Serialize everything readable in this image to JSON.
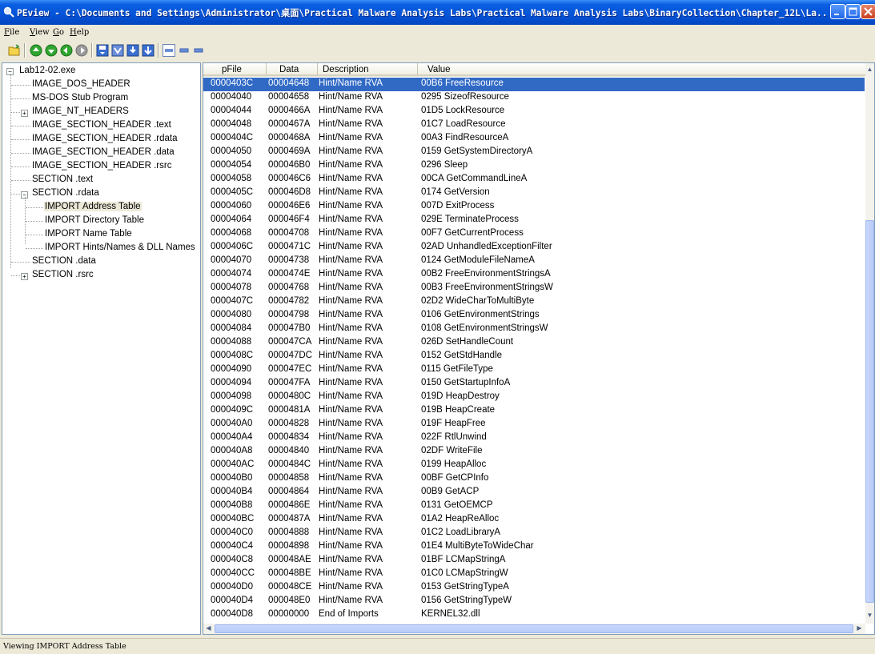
{
  "window": {
    "title": "PEview - C:\\Documents and Settings\\Administrator\\桌面\\Practical Malware Analysis Labs\\Practical Malware Analysis Labs\\BinaryCollection\\Chapter_12L\\La..."
  },
  "menu": {
    "items": [
      "File",
      "View",
      "Go",
      "Help"
    ]
  },
  "tree": {
    "root": "Lab12-02.exe",
    "items": [
      "IMAGE_DOS_HEADER",
      "MS-DOS Stub Program",
      "IMAGE_NT_HEADERS",
      "IMAGE_SECTION_HEADER .text",
      "IMAGE_SECTION_HEADER .rdata",
      "IMAGE_SECTION_HEADER .data",
      "IMAGE_SECTION_HEADER .rsrc",
      "SECTION .text",
      "SECTION .rdata",
      "IMPORT Address Table",
      "IMPORT Directory Table",
      "IMPORT Name Table",
      "IMPORT Hints/Names & DLL Names",
      "SECTION .data",
      "SECTION .rsrc"
    ],
    "expanders": {
      "root": "−",
      "nt_headers": "+",
      "rdata": "−",
      "rsrc": "+"
    }
  },
  "list": {
    "columns": [
      "pFile",
      "Data",
      "Description",
      "Value"
    ],
    "rows": [
      [
        "0000403C",
        "00004648",
        "Hint/Name RVA",
        "00B6  FreeResource"
      ],
      [
        "00004040",
        "00004658",
        "Hint/Name RVA",
        "0295  SizeofResource"
      ],
      [
        "00004044",
        "0000466A",
        "Hint/Name RVA",
        "01D5  LockResource"
      ],
      [
        "00004048",
        "0000467A",
        "Hint/Name RVA",
        "01C7  LoadResource"
      ],
      [
        "0000404C",
        "0000468A",
        "Hint/Name RVA",
        "00A3  FindResourceA"
      ],
      [
        "00004050",
        "0000469A",
        "Hint/Name RVA",
        "0159  GetSystemDirectoryA"
      ],
      [
        "00004054",
        "000046B0",
        "Hint/Name RVA",
        "0296  Sleep"
      ],
      [
        "00004058",
        "000046C6",
        "Hint/Name RVA",
        "00CA  GetCommandLineA"
      ],
      [
        "0000405C",
        "000046D8",
        "Hint/Name RVA",
        "0174  GetVersion"
      ],
      [
        "00004060",
        "000046E6",
        "Hint/Name RVA",
        "007D  ExitProcess"
      ],
      [
        "00004064",
        "000046F4",
        "Hint/Name RVA",
        "029E  TerminateProcess"
      ],
      [
        "00004068",
        "00004708",
        "Hint/Name RVA",
        "00F7  GetCurrentProcess"
      ],
      [
        "0000406C",
        "0000471C",
        "Hint/Name RVA",
        "02AD  UnhandledExceptionFilter"
      ],
      [
        "00004070",
        "00004738",
        "Hint/Name RVA",
        "0124  GetModuleFileNameA"
      ],
      [
        "00004074",
        "0000474E",
        "Hint/Name RVA",
        "00B2  FreeEnvironmentStringsA"
      ],
      [
        "00004078",
        "00004768",
        "Hint/Name RVA",
        "00B3  FreeEnvironmentStringsW"
      ],
      [
        "0000407C",
        "00004782",
        "Hint/Name RVA",
        "02D2  WideCharToMultiByte"
      ],
      [
        "00004080",
        "00004798",
        "Hint/Name RVA",
        "0106  GetEnvironmentStrings"
      ],
      [
        "00004084",
        "000047B0",
        "Hint/Name RVA",
        "0108  GetEnvironmentStringsW"
      ],
      [
        "00004088",
        "000047CA",
        "Hint/Name RVA",
        "026D  SetHandleCount"
      ],
      [
        "0000408C",
        "000047DC",
        "Hint/Name RVA",
        "0152  GetStdHandle"
      ],
      [
        "00004090",
        "000047EC",
        "Hint/Name RVA",
        "0115  GetFileType"
      ],
      [
        "00004094",
        "000047FA",
        "Hint/Name RVA",
        "0150  GetStartupInfoA"
      ],
      [
        "00004098",
        "0000480C",
        "Hint/Name RVA",
        "019D  HeapDestroy"
      ],
      [
        "0000409C",
        "0000481A",
        "Hint/Name RVA",
        "019B  HeapCreate"
      ],
      [
        "000040A0",
        "00004828",
        "Hint/Name RVA",
        "019F  HeapFree"
      ],
      [
        "000040A4",
        "00004834",
        "Hint/Name RVA",
        "022F  RtlUnwind"
      ],
      [
        "000040A8",
        "00004840",
        "Hint/Name RVA",
        "02DF  WriteFile"
      ],
      [
        "000040AC",
        "0000484C",
        "Hint/Name RVA",
        "0199  HeapAlloc"
      ],
      [
        "000040B0",
        "00004858",
        "Hint/Name RVA",
        "00BF  GetCPInfo"
      ],
      [
        "000040B4",
        "00004864",
        "Hint/Name RVA",
        "00B9  GetACP"
      ],
      [
        "000040B8",
        "0000486E",
        "Hint/Name RVA",
        "0131  GetOEMCP"
      ],
      [
        "000040BC",
        "0000487A",
        "Hint/Name RVA",
        "01A2  HeapReAlloc"
      ],
      [
        "000040C0",
        "00004888",
        "Hint/Name RVA",
        "01C2  LoadLibraryA"
      ],
      [
        "000040C4",
        "00004898",
        "Hint/Name RVA",
        "01E4  MultiByteToWideChar"
      ],
      [
        "000040C8",
        "000048AE",
        "Hint/Name RVA",
        "01BF  LCMapStringA"
      ],
      [
        "000040CC",
        "000048BE",
        "Hint/Name RVA",
        "01C0  LCMapStringW"
      ],
      [
        "000040D0",
        "000048CE",
        "Hint/Name RVA",
        "0153  GetStringTypeA"
      ],
      [
        "000040D4",
        "000048E0",
        "Hint/Name RVA",
        "0156  GetStringTypeW"
      ],
      [
        "000040D8",
        "00000000",
        "End of Imports",
        "KERNEL32.dll"
      ]
    ]
  },
  "status": {
    "text": "Viewing IMPORT Address Table"
  },
  "colors": {
    "selection": "#316ac5",
    "titlebar": "#0553d8"
  }
}
